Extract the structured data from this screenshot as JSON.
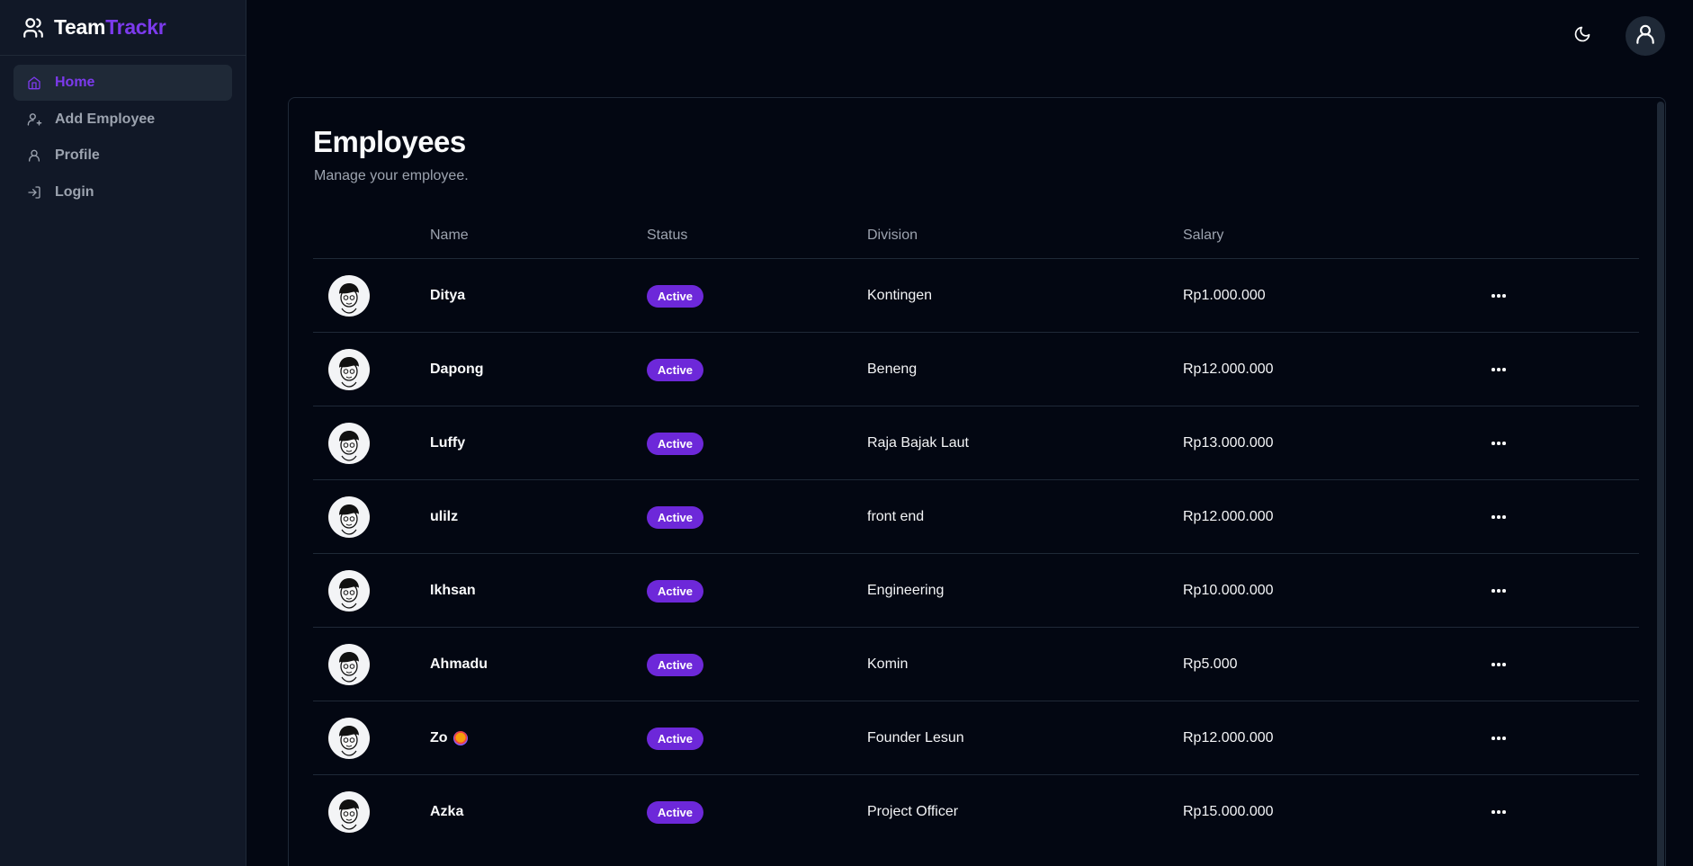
{
  "brand": {
    "part1": "Team",
    "part2": "Trackr",
    "icon": "users-icon",
    "accent": "#7c3aed"
  },
  "sidebar": {
    "items": [
      {
        "label": "Home",
        "icon": "home-icon",
        "active": true
      },
      {
        "label": "Add Employee",
        "icon": "user-plus-icon",
        "active": false
      },
      {
        "label": "Profile",
        "icon": "user-icon",
        "active": false
      },
      {
        "label": "Login",
        "icon": "login-icon",
        "active": false
      }
    ]
  },
  "header": {
    "theme_icon": "moon-icon",
    "avatar_icon": "user-icon"
  },
  "main": {
    "title": "Employees",
    "subtitle": "Manage your employee.",
    "columns": [
      "Name",
      "Status",
      "Division",
      "Salary"
    ],
    "rows": [
      {
        "name": "Ditya",
        "status": "Active",
        "division": "Kontingen",
        "salary": "Rp1.000.000"
      },
      {
        "name": "Dapong",
        "status": "Active",
        "division": "Beneng",
        "salary": "Rp12.000.000"
      },
      {
        "name": "Luffy",
        "status": "Active",
        "division": "Raja Bajak Laut",
        "salary": "Rp13.000.000"
      },
      {
        "name": "ulilz",
        "status": "Active",
        "division": "front end",
        "salary": "Rp12.000.000"
      },
      {
        "name": "Ikhsan",
        "status": "Active",
        "division": "Engineering",
        "salary": "Rp10.000.000"
      },
      {
        "name": "Ahmadu",
        "status": "Active",
        "division": "Komin",
        "salary": "Rp5.000"
      },
      {
        "name": "Zo",
        "status": "Active",
        "division": "Founder Lesun",
        "salary": "Rp12.000.000"
      },
      {
        "name": "Azka",
        "status": "Active",
        "division": "Project Officer",
        "salary": "Rp15.000.000"
      }
    ]
  }
}
